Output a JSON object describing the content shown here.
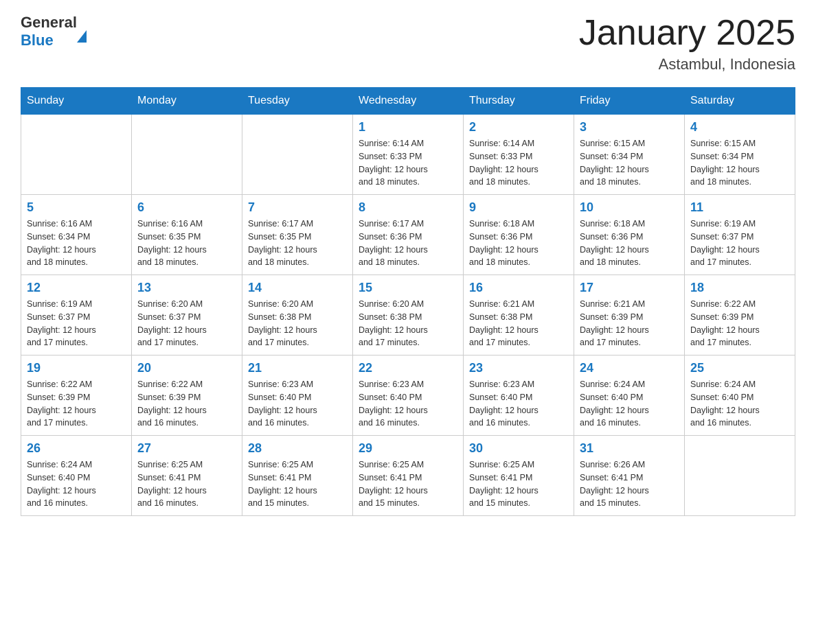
{
  "header": {
    "logo_general": "General",
    "logo_blue": "Blue",
    "month_title": "January 2025",
    "location": "Astambul, Indonesia"
  },
  "days_of_week": [
    "Sunday",
    "Monday",
    "Tuesday",
    "Wednesday",
    "Thursday",
    "Friday",
    "Saturday"
  ],
  "weeks": [
    [
      {
        "day": "",
        "info": ""
      },
      {
        "day": "",
        "info": ""
      },
      {
        "day": "",
        "info": ""
      },
      {
        "day": "1",
        "info": "Sunrise: 6:14 AM\nSunset: 6:33 PM\nDaylight: 12 hours\nand 18 minutes."
      },
      {
        "day": "2",
        "info": "Sunrise: 6:14 AM\nSunset: 6:33 PM\nDaylight: 12 hours\nand 18 minutes."
      },
      {
        "day": "3",
        "info": "Sunrise: 6:15 AM\nSunset: 6:34 PM\nDaylight: 12 hours\nand 18 minutes."
      },
      {
        "day": "4",
        "info": "Sunrise: 6:15 AM\nSunset: 6:34 PM\nDaylight: 12 hours\nand 18 minutes."
      }
    ],
    [
      {
        "day": "5",
        "info": "Sunrise: 6:16 AM\nSunset: 6:34 PM\nDaylight: 12 hours\nand 18 minutes."
      },
      {
        "day": "6",
        "info": "Sunrise: 6:16 AM\nSunset: 6:35 PM\nDaylight: 12 hours\nand 18 minutes."
      },
      {
        "day": "7",
        "info": "Sunrise: 6:17 AM\nSunset: 6:35 PM\nDaylight: 12 hours\nand 18 minutes."
      },
      {
        "day": "8",
        "info": "Sunrise: 6:17 AM\nSunset: 6:36 PM\nDaylight: 12 hours\nand 18 minutes."
      },
      {
        "day": "9",
        "info": "Sunrise: 6:18 AM\nSunset: 6:36 PM\nDaylight: 12 hours\nand 18 minutes."
      },
      {
        "day": "10",
        "info": "Sunrise: 6:18 AM\nSunset: 6:36 PM\nDaylight: 12 hours\nand 18 minutes."
      },
      {
        "day": "11",
        "info": "Sunrise: 6:19 AM\nSunset: 6:37 PM\nDaylight: 12 hours\nand 17 minutes."
      }
    ],
    [
      {
        "day": "12",
        "info": "Sunrise: 6:19 AM\nSunset: 6:37 PM\nDaylight: 12 hours\nand 17 minutes."
      },
      {
        "day": "13",
        "info": "Sunrise: 6:20 AM\nSunset: 6:37 PM\nDaylight: 12 hours\nand 17 minutes."
      },
      {
        "day": "14",
        "info": "Sunrise: 6:20 AM\nSunset: 6:38 PM\nDaylight: 12 hours\nand 17 minutes."
      },
      {
        "day": "15",
        "info": "Sunrise: 6:20 AM\nSunset: 6:38 PM\nDaylight: 12 hours\nand 17 minutes."
      },
      {
        "day": "16",
        "info": "Sunrise: 6:21 AM\nSunset: 6:38 PM\nDaylight: 12 hours\nand 17 minutes."
      },
      {
        "day": "17",
        "info": "Sunrise: 6:21 AM\nSunset: 6:39 PM\nDaylight: 12 hours\nand 17 minutes."
      },
      {
        "day": "18",
        "info": "Sunrise: 6:22 AM\nSunset: 6:39 PM\nDaylight: 12 hours\nand 17 minutes."
      }
    ],
    [
      {
        "day": "19",
        "info": "Sunrise: 6:22 AM\nSunset: 6:39 PM\nDaylight: 12 hours\nand 17 minutes."
      },
      {
        "day": "20",
        "info": "Sunrise: 6:22 AM\nSunset: 6:39 PM\nDaylight: 12 hours\nand 16 minutes."
      },
      {
        "day": "21",
        "info": "Sunrise: 6:23 AM\nSunset: 6:40 PM\nDaylight: 12 hours\nand 16 minutes."
      },
      {
        "day": "22",
        "info": "Sunrise: 6:23 AM\nSunset: 6:40 PM\nDaylight: 12 hours\nand 16 minutes."
      },
      {
        "day": "23",
        "info": "Sunrise: 6:23 AM\nSunset: 6:40 PM\nDaylight: 12 hours\nand 16 minutes."
      },
      {
        "day": "24",
        "info": "Sunrise: 6:24 AM\nSunset: 6:40 PM\nDaylight: 12 hours\nand 16 minutes."
      },
      {
        "day": "25",
        "info": "Sunrise: 6:24 AM\nSunset: 6:40 PM\nDaylight: 12 hours\nand 16 minutes."
      }
    ],
    [
      {
        "day": "26",
        "info": "Sunrise: 6:24 AM\nSunset: 6:40 PM\nDaylight: 12 hours\nand 16 minutes."
      },
      {
        "day": "27",
        "info": "Sunrise: 6:25 AM\nSunset: 6:41 PM\nDaylight: 12 hours\nand 16 minutes."
      },
      {
        "day": "28",
        "info": "Sunrise: 6:25 AM\nSunset: 6:41 PM\nDaylight: 12 hours\nand 15 minutes."
      },
      {
        "day": "29",
        "info": "Sunrise: 6:25 AM\nSunset: 6:41 PM\nDaylight: 12 hours\nand 15 minutes."
      },
      {
        "day": "30",
        "info": "Sunrise: 6:25 AM\nSunset: 6:41 PM\nDaylight: 12 hours\nand 15 minutes."
      },
      {
        "day": "31",
        "info": "Sunrise: 6:26 AM\nSunset: 6:41 PM\nDaylight: 12 hours\nand 15 minutes."
      },
      {
        "day": "",
        "info": ""
      }
    ]
  ]
}
